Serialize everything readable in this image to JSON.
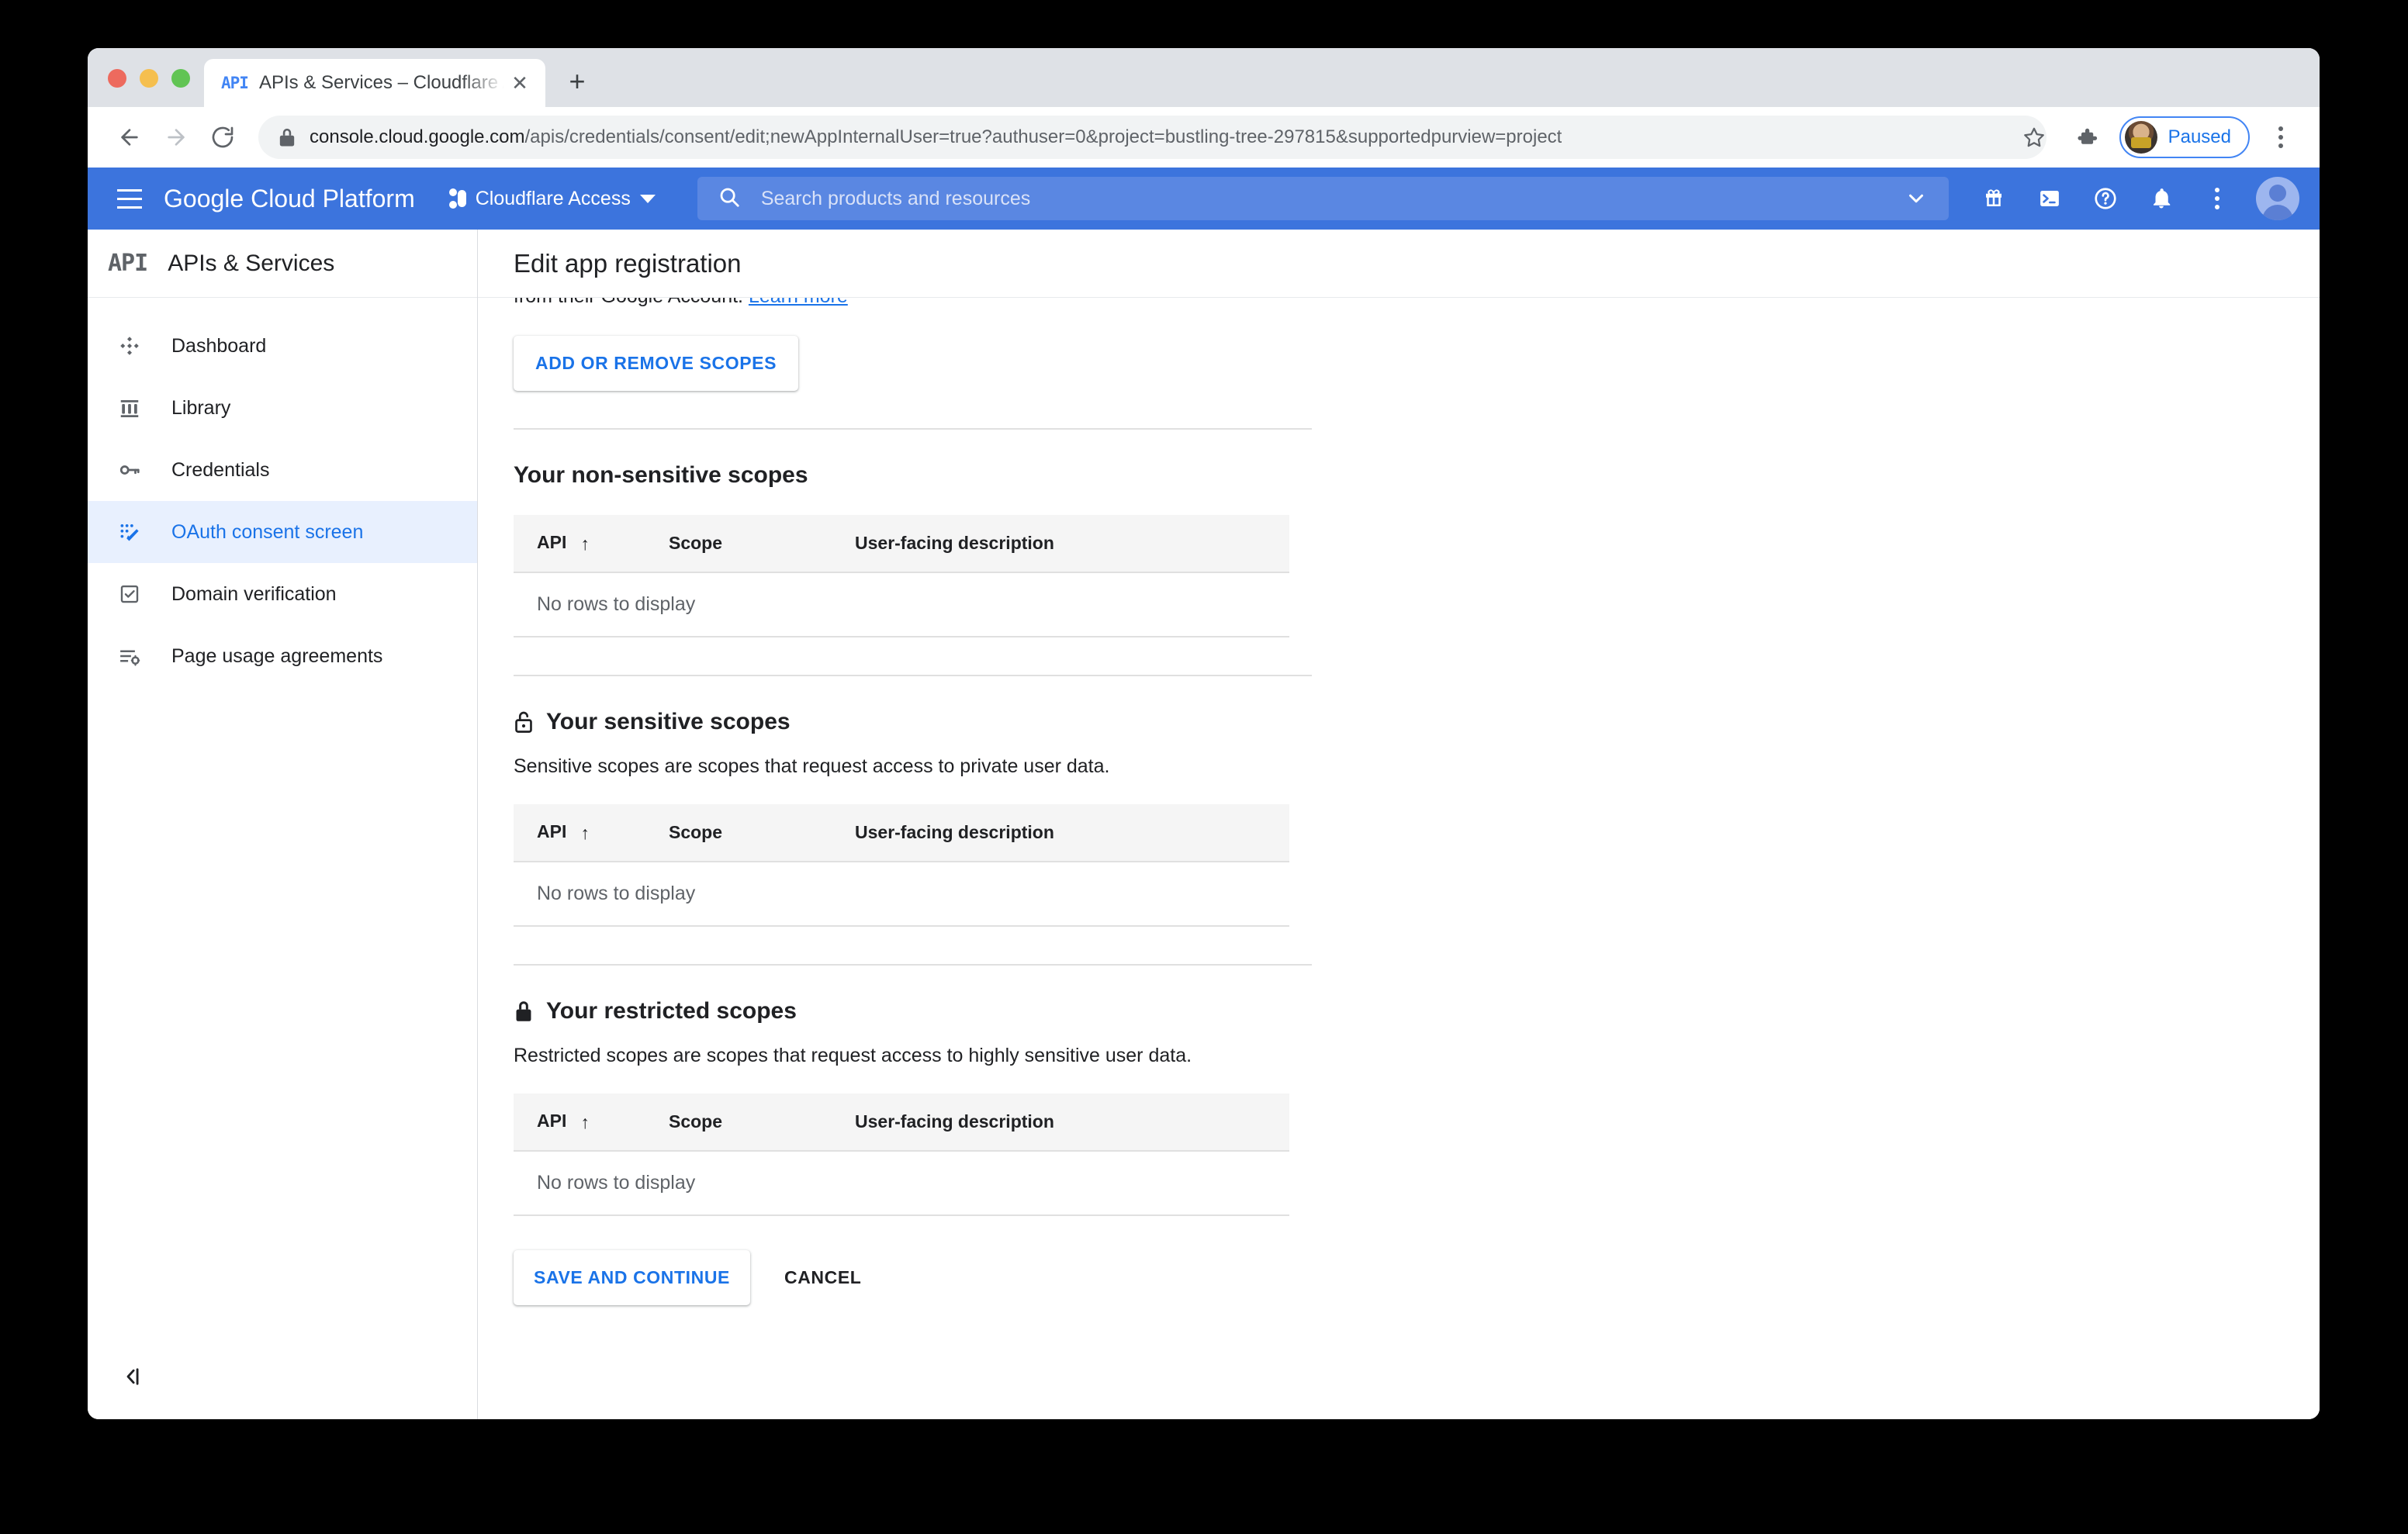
{
  "browser": {
    "tab": {
      "favicon_text": "API",
      "title": "APIs & Services – Cloudflare Ac",
      "close_icon": "✕"
    },
    "new_tab_label": "+",
    "toolbar": {
      "back_icon": "back-arrow-icon",
      "forward_icon": "forward-arrow-icon",
      "reload_icon": "reload-icon",
      "lock_icon": "padlock-icon",
      "url_host": "console.cloud.google.com",
      "url_path": "/apis/credentials/consent/edit;newAppInternalUser=true?authuser=0&project=bustling-tree-297815&supportedpurview=project",
      "star_icon": "star-icon",
      "extensions_icon": "puzzle-piece-icon",
      "profile_label": "Paused",
      "menu_icon": "three-dot-menu-icon"
    }
  },
  "gcp_header": {
    "menu_icon": "hamburger-menu-icon",
    "brand": "Google Cloud Platform",
    "project_name": "Cloudflare Access",
    "project_caret": "chevron-down-icon",
    "search": {
      "placeholder": "Search products and resources",
      "icon": "search-icon",
      "expand_icon": "chevron-down-icon"
    },
    "icons": [
      {
        "name": "gift-icon"
      },
      {
        "name": "cloud-shell-terminal-icon"
      },
      {
        "name": "help-question-icon"
      },
      {
        "name": "notifications-bell-icon"
      },
      {
        "name": "three-dot-menu-icon"
      },
      {
        "name": "account-avatar-icon"
      }
    ],
    "accent_color": "#3c74dd"
  },
  "sidebar": {
    "logo_text": "API",
    "title": "APIs & Services",
    "items": [
      {
        "label": "Dashboard",
        "icon": "dashboard-icon",
        "active": false
      },
      {
        "label": "Library",
        "icon": "library-icon",
        "active": false
      },
      {
        "label": "Credentials",
        "icon": "key-icon",
        "active": false
      },
      {
        "label": "OAuth consent screen",
        "icon": "oauth-consent-icon",
        "active": true
      },
      {
        "label": "Domain verification",
        "icon": "checkbox-icon",
        "active": false
      },
      {
        "label": "Page usage agreements",
        "icon": "page-usage-icon",
        "active": false
      }
    ],
    "collapse_icon": "collapse-panel-icon",
    "active_color": "#1a73e8",
    "active_bg": "#e8f0fe"
  },
  "main": {
    "page_title": "Edit app registration",
    "clipped_text": "from their Google Account.",
    "clipped_link": "Learn more",
    "add_remove_scopes_label": "ADD OR REMOVE SCOPES",
    "sections": [
      {
        "heading": "Your non-sensitive scopes",
        "lock_icon": null,
        "description": null,
        "columns": [
          "API",
          "Scope",
          "User-facing description"
        ],
        "sort_indicator": "↑",
        "empty_message": "No rows to display",
        "rows": []
      },
      {
        "heading": "Your sensitive scopes",
        "lock_icon": "unlocked-padlock-icon",
        "description": "Sensitive scopes are scopes that request access to private user data.",
        "columns": [
          "API",
          "Scope",
          "User-facing description"
        ],
        "sort_indicator": "↑",
        "empty_message": "No rows to display",
        "rows": []
      },
      {
        "heading": "Your restricted scopes",
        "lock_icon": "locked-padlock-icon",
        "description": "Restricted scopes are scopes that request access to highly sensitive user data.",
        "columns": [
          "API",
          "Scope",
          "User-facing description"
        ],
        "sort_indicator": "↑",
        "empty_message": "No rows to display",
        "rows": []
      }
    ],
    "save_label": "SAVE AND CONTINUE",
    "cancel_label": "CANCEL",
    "link_color": "#1a73e8"
  }
}
